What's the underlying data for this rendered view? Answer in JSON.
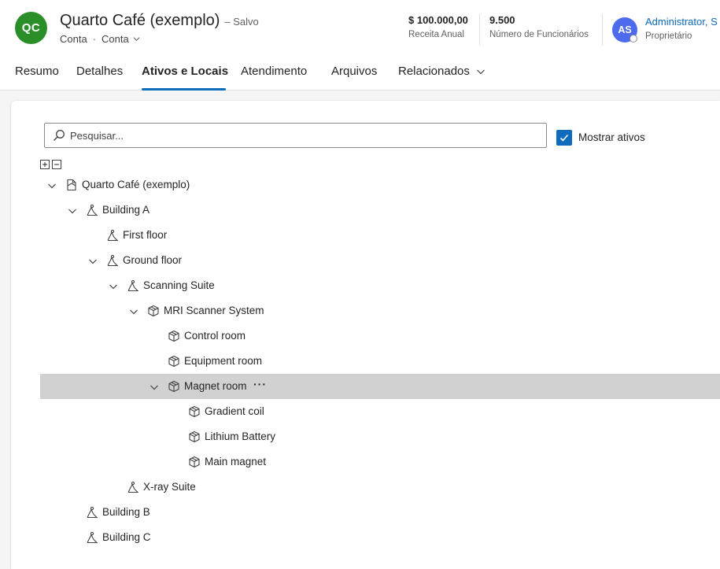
{
  "header": {
    "avatar_initials": "QC",
    "title": "Quarto Café (exemplo)",
    "save_status": "– Salvo",
    "entity": "Conta",
    "separator": "·",
    "form": "Conta",
    "kpis": [
      {
        "value": "$ 100.000,00",
        "label": "Receita Anual"
      },
      {
        "value": "9.500",
        "label": "Número de Funcionários"
      }
    ],
    "owner": {
      "initials": "AS",
      "name": "Administrator, S",
      "role": "Proprietário"
    }
  },
  "tabs": [
    {
      "label": "Resumo"
    },
    {
      "label": "Detalhes"
    },
    {
      "label": "Ativos e Locais",
      "active": true
    },
    {
      "label": "Atendimento"
    },
    {
      "label": "Arquivos"
    },
    {
      "label": "Relacionados",
      "icon": "chevron-down-icon"
    }
  ],
  "search": {
    "placeholder": "Pesquisar...",
    "value": ""
  },
  "show_assets": {
    "label": "Mostrar ativos",
    "checked": true
  },
  "tree": [
    {
      "label": "Quarto Café (exemplo)",
      "type": "account",
      "level": 0,
      "expanded": true
    },
    {
      "label": "Building A",
      "type": "location",
      "level": 1,
      "expanded": true
    },
    {
      "label": "First floor",
      "type": "location",
      "level": 2
    },
    {
      "label": "Ground floor",
      "type": "location",
      "level": 2,
      "expanded": true
    },
    {
      "label": "Scanning Suite",
      "type": "location",
      "level": 3,
      "expanded": true
    },
    {
      "label": "MRI Scanner System",
      "type": "asset",
      "level": 4,
      "expanded": true
    },
    {
      "label": "Control room",
      "type": "asset",
      "level": 5
    },
    {
      "label": "Equipment room",
      "type": "asset",
      "level": 5
    },
    {
      "label": "Magnet room",
      "type": "asset",
      "level": 5,
      "expanded": true,
      "selected": true,
      "more": "···"
    },
    {
      "label": "Gradient coil",
      "type": "asset",
      "level": 6
    },
    {
      "label": "Lithium Battery",
      "type": "asset",
      "level": 6
    },
    {
      "label": "Main magnet",
      "type": "asset",
      "level": 6
    },
    {
      "label": "X-ray Suite",
      "type": "location",
      "level": 3
    },
    {
      "label": "Building B",
      "type": "location",
      "level": 1
    },
    {
      "label": "Building C",
      "type": "location",
      "level": 1
    }
  ],
  "colors": {
    "brand": "#0f6cbd",
    "account_avatar": "#2a8f28",
    "owner_avatar": "#4f6bed",
    "selected_row": "#d1d1d1"
  }
}
